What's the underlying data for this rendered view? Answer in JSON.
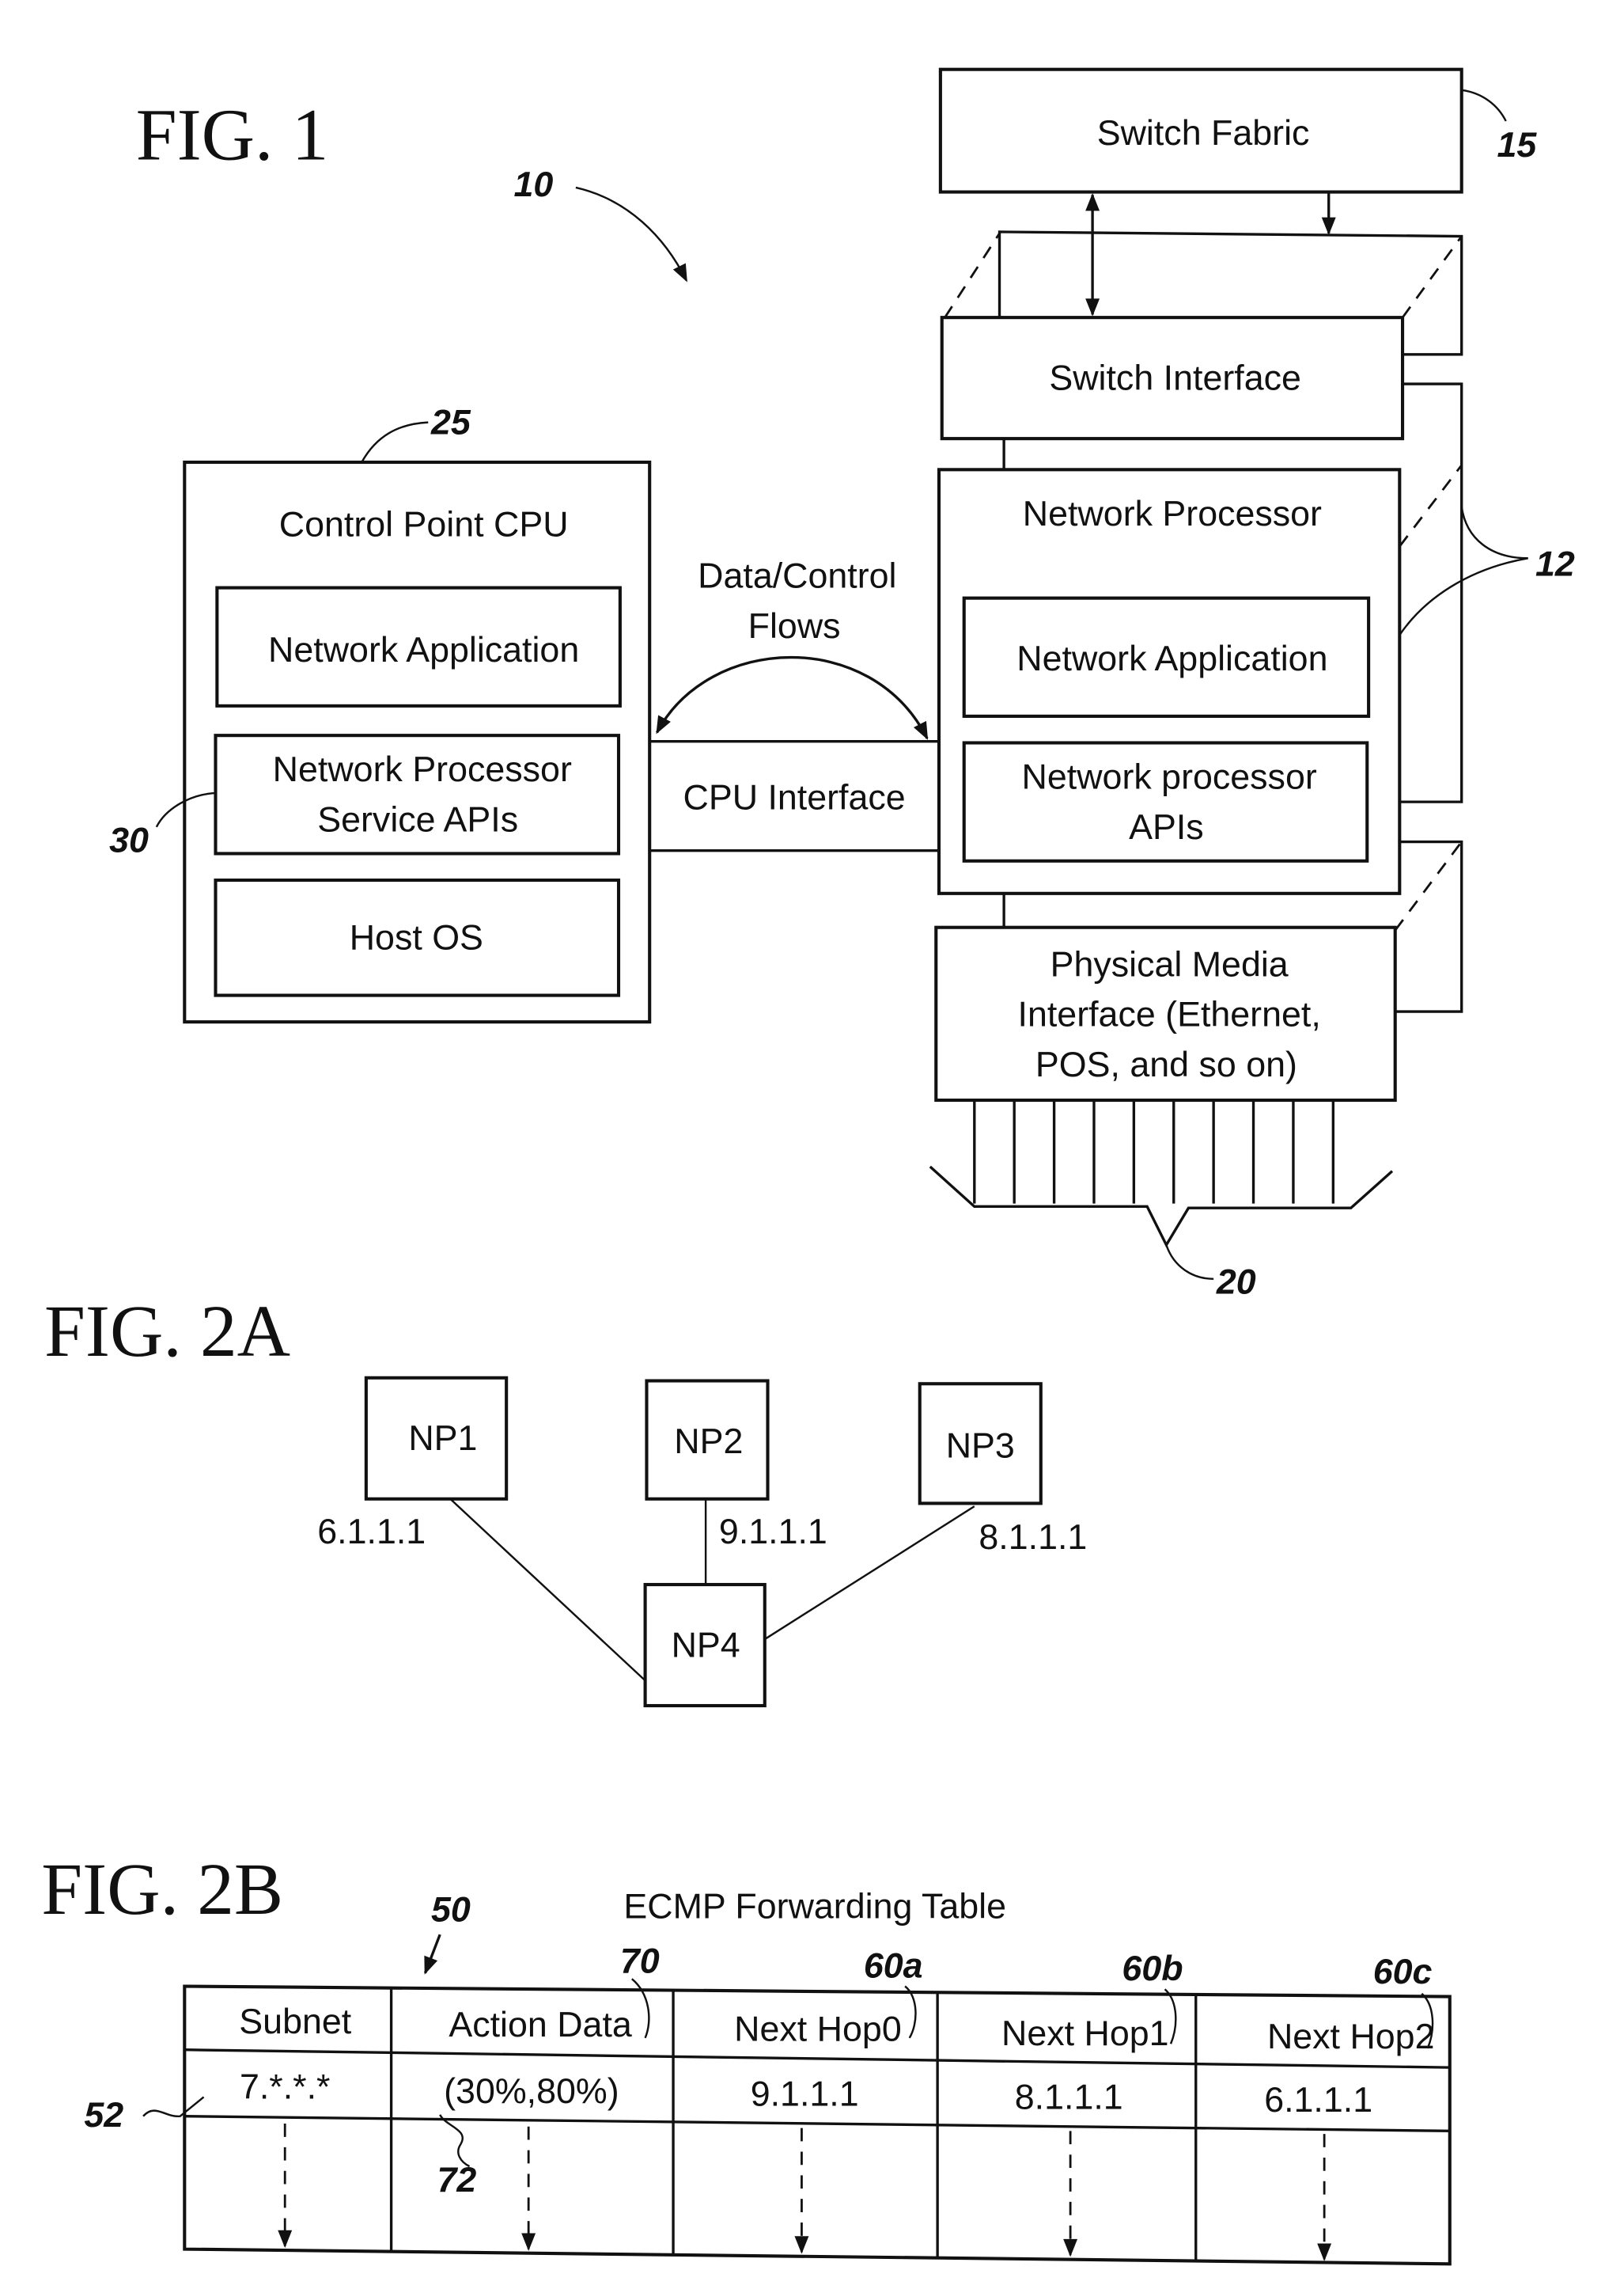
{
  "fig1": {
    "title": "FIG. 1",
    "ref_system": "10",
    "switch_fabric": {
      "label": "Switch Fabric",
      "ref": "15"
    },
    "switch_interface": {
      "label": "Switch Interface"
    },
    "network_processor": {
      "title": "Network Processor",
      "network_application": "Network Application",
      "apis_line1": "Network processor",
      "apis_line2": "APIs",
      "ref": "12"
    },
    "physical_media_interface": {
      "line1": "Physical Media",
      "line2": "Interface (Ethernet,",
      "line3": "POS, and so on)",
      "ports_ref": "20",
      "port_count": 10
    },
    "control_point_cpu": {
      "title": "Control Point CPU",
      "ref": "25",
      "network_application": "Network Application",
      "service_apis_line1": "Network Processor",
      "service_apis_line2": "Service APIs",
      "service_apis_ref": "30",
      "host_os": "Host OS"
    },
    "flows_line1": "Data/Control",
    "flows_line2": "Flows",
    "cpu_interface": "CPU Interface"
  },
  "fig2a": {
    "title": "FIG. 2A",
    "nodes": [
      {
        "id": "NP1"
      },
      {
        "id": "NP2"
      },
      {
        "id": "NP3"
      },
      {
        "id": "NP4"
      }
    ],
    "links": [
      {
        "from": "NP1",
        "to": "NP4",
        "address": "6.1.1.1"
      },
      {
        "from": "NP2",
        "to": "NP4",
        "address": "9.1.1.1"
      },
      {
        "from": "NP3",
        "to": "NP4",
        "address": "8.1.1.1"
      }
    ]
  },
  "fig2b": {
    "title": "FIG. 2B",
    "table_title": "ECMP Forwarding Table",
    "table_ref": "50",
    "row_ref": "52",
    "action_ref": "72",
    "columns": [
      {
        "header": "Subnet",
        "ref": ""
      },
      {
        "header": "Action Data",
        "ref": "70"
      },
      {
        "header": "Next Hop0",
        "ref": "60a"
      },
      {
        "header": "Next Hop1",
        "ref": "60b"
      },
      {
        "header": "Next Hop2",
        "ref": "60c"
      }
    ],
    "rows": [
      [
        "7.*.*.*",
        "(30%,80%)",
        "9.1.1.1",
        "8.1.1.1",
        "6.1.1.1"
      ]
    ]
  }
}
